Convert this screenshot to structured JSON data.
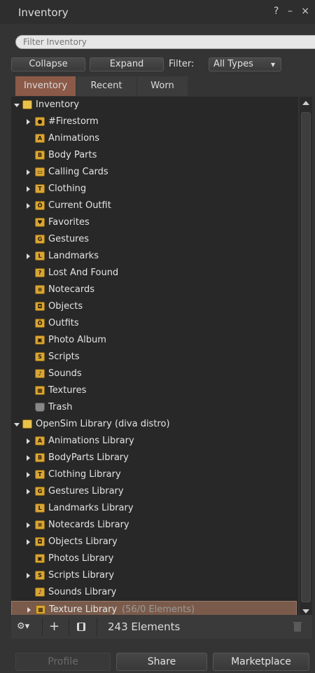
{
  "window": {
    "title": "Inventory",
    "help": "?",
    "minimize": "–",
    "close": "×"
  },
  "filter": {
    "placeholder": "Filter Inventory"
  },
  "toolbar": {
    "collapse": "Collapse",
    "expand": "Expand",
    "filter_label": "Filter:",
    "type_selected": "All Types",
    "dropdown_arrow": "▾"
  },
  "tabs": [
    "Inventory",
    "Recent",
    "Worn"
  ],
  "tree": [
    {
      "label": "Inventory",
      "arrow": "down",
      "icon": "open-folder",
      "glyph": ""
    },
    {
      "label": "#Firestorm",
      "arrow": "right",
      "icon": "firestorm-folder",
      "glyph": "●"
    },
    {
      "label": "Animations",
      "arrow": "",
      "icon": "animations-folder",
      "glyph": "A"
    },
    {
      "label": "Body Parts",
      "arrow": "",
      "icon": "bodyparts-folder",
      "glyph": "B"
    },
    {
      "label": "Calling Cards",
      "arrow": "right",
      "icon": "callingcards-folder",
      "glyph": "▭"
    },
    {
      "label": "Clothing",
      "arrow": "right",
      "icon": "clothing-folder",
      "glyph": "T"
    },
    {
      "label": "Current Outfit",
      "arrow": "right",
      "icon": "outfit-folder",
      "glyph": "Ö"
    },
    {
      "label": "Favorites",
      "arrow": "",
      "icon": "favorites-folder",
      "glyph": "♥"
    },
    {
      "label": "Gestures",
      "arrow": "",
      "icon": "gestures-folder",
      "glyph": "G"
    },
    {
      "label": "Landmarks",
      "arrow": "right",
      "icon": "landmarks-folder",
      "glyph": "L"
    },
    {
      "label": "Lost And Found",
      "arrow": "",
      "icon": "lostandfound-folder",
      "glyph": "?"
    },
    {
      "label": "Notecards",
      "arrow": "",
      "icon": "notecards-folder",
      "glyph": "≡"
    },
    {
      "label": "Objects",
      "arrow": "",
      "icon": "objects-folder",
      "glyph": "◘"
    },
    {
      "label": "Outfits",
      "arrow": "",
      "icon": "outfits-folder",
      "glyph": "Ö"
    },
    {
      "label": "Photo Album",
      "arrow": "",
      "icon": "photoalbum-folder",
      "glyph": "▣"
    },
    {
      "label": "Scripts",
      "arrow": "",
      "icon": "scripts-folder",
      "glyph": "S"
    },
    {
      "label": "Sounds",
      "arrow": "",
      "icon": "sounds-folder",
      "glyph": "♪"
    },
    {
      "label": "Textures",
      "arrow": "",
      "icon": "textures-folder",
      "glyph": "▦"
    },
    {
      "label": "Trash",
      "arrow": "",
      "icon": "trash",
      "glyph": ""
    },
    {
      "label": "OpenSim Library (diva distro)",
      "arrow": "down",
      "icon": "open-folder",
      "glyph": ""
    },
    {
      "label": "Animations Library",
      "arrow": "right",
      "icon": "animations-folder",
      "glyph": "A"
    },
    {
      "label": "BodyParts Library",
      "arrow": "right",
      "icon": "bodyparts-folder",
      "glyph": "B"
    },
    {
      "label": "Clothing Library",
      "arrow": "right",
      "icon": "clothing-folder",
      "glyph": "T"
    },
    {
      "label": "Gestures Library",
      "arrow": "right",
      "icon": "gestures-folder",
      "glyph": "G"
    },
    {
      "label": "Landmarks Library",
      "arrow": "",
      "icon": "landmarks-folder",
      "glyph": "L"
    },
    {
      "label": "Notecards Library",
      "arrow": "right",
      "icon": "notecards-folder",
      "glyph": "≡"
    },
    {
      "label": "Objects Library",
      "arrow": "right",
      "icon": "objects-folder",
      "glyph": "◘"
    },
    {
      "label": "Photos Library",
      "arrow": "",
      "icon": "photoalbum-folder",
      "glyph": "▣"
    },
    {
      "label": "Scripts Library",
      "arrow": "right",
      "icon": "scripts-folder",
      "glyph": "S"
    },
    {
      "label": "Sounds Library",
      "arrow": "",
      "icon": "sounds-folder",
      "glyph": "♪"
    },
    {
      "label": "Texture Library",
      "suffix": " (56/0 Elements)",
      "arrow": "right",
      "icon": "textures-folder",
      "glyph": "▦",
      "selected": true
    }
  ],
  "bottombar": {
    "gear": "⚙▾",
    "add": "+",
    "count": "243 Elements"
  },
  "footer": {
    "profile": "Profile",
    "share": "Share",
    "marketplace": "Marketplace"
  },
  "colors": {
    "accent_tab": "#8c5a48",
    "selected_row": "#7a5a4a",
    "folder": "#d8a536"
  }
}
